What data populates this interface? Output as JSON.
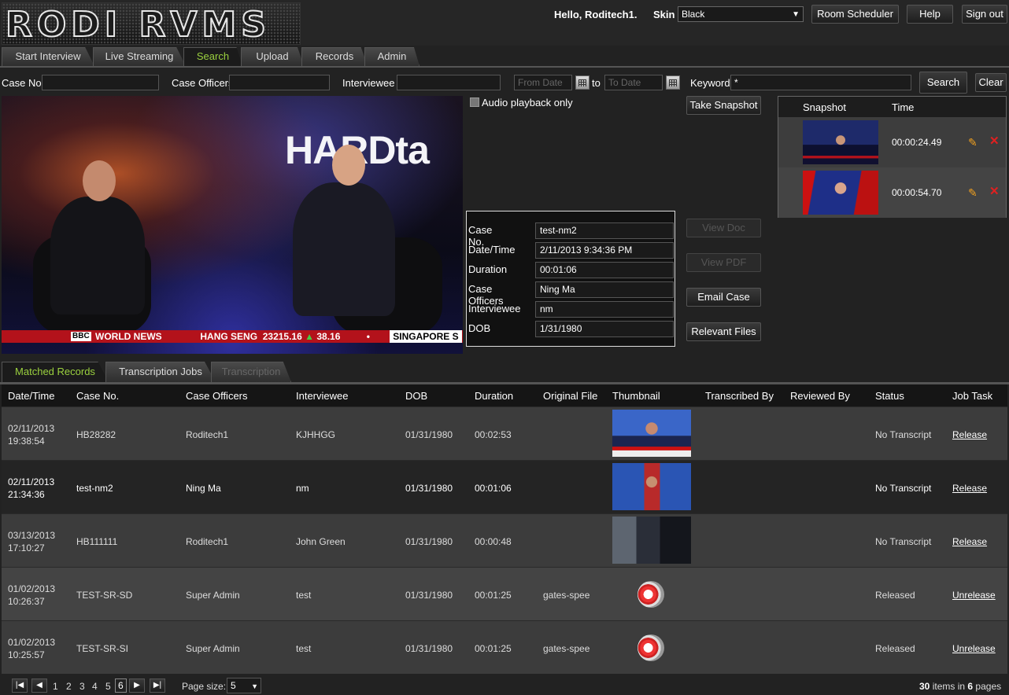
{
  "header": {
    "logo_text": "RODI RVMS",
    "greeting": "Hello, Roditech1.",
    "skin_label": "Skin",
    "skin_value": "Black",
    "buttons": {
      "room_scheduler": "Room Scheduler",
      "help": "Help",
      "sign_out": "Sign out"
    }
  },
  "main_tabs": [
    "Start Interview",
    "Live Streaming",
    "Search",
    "Upload",
    "Records",
    "Admin"
  ],
  "search": {
    "case_no_label": "Case No.",
    "case_officers_label": "Case Officers",
    "interviewee_label": "Interviewee",
    "from_date_placeholder": "From Date",
    "to_label": "to",
    "to_date_placeholder": "To Date",
    "keyword_label": "Keyword",
    "keyword_value": "*",
    "search_button": "Search",
    "clear_button": "Clear"
  },
  "video": {
    "overlay_text": "HARDta",
    "ticker_bbc": "BBC",
    "ticker_channel": "WORLD NEWS",
    "ticker_market1": "HANG SENG",
    "ticker_value1": "23215.16",
    "ticker_change1": "38.16",
    "ticker_market2": "SINGAPORE S"
  },
  "audio_only_label": "Audio playback only",
  "details": {
    "case_no_label": "Case No.",
    "case_no": "test-nm2",
    "datetime_label": "Date/Time",
    "datetime": "2/11/2013 9:34:36 PM",
    "duration_label": "Duration",
    "duration": "00:01:06",
    "officers_label": "Case Officers",
    "officers": "Ning Ma",
    "interviewee_label": "Interviewee",
    "interviewee": "nm",
    "dob_label": "DOB",
    "dob": "1/31/1980"
  },
  "actions": {
    "take_snapshot": "Take Snapshot",
    "view_doc": "View Doc",
    "view_pdf": "View PDF",
    "email_case": "Email Case",
    "relevant_files": "Relevant Files"
  },
  "snapshots": {
    "col_snapshot": "Snapshot",
    "col_time": "Time",
    "rows": [
      {
        "time": "00:00:24.49"
      },
      {
        "time": "00:00:54.70"
      }
    ]
  },
  "lower_tabs": [
    "Matched Records",
    "Transcription Jobs",
    "Transcription"
  ],
  "grid": {
    "columns": [
      "Date/Time",
      "Case No.",
      "Case Officers",
      "Interviewee",
      "DOB",
      "Duration",
      "Original File",
      "Thumbnail",
      "Transcribed By",
      "Reviewed By",
      "Status",
      "Job Task"
    ],
    "rows": [
      {
        "date": "02/11/2013",
        "time": "19:38:54",
        "case_no": "HB28282",
        "officers": "Roditech1",
        "interviewee": "KJHHGG",
        "dob": "01/31/1980",
        "duration": "00:02:53",
        "file": "",
        "status": "No Transcript",
        "task": "Release"
      },
      {
        "date": "02/11/2013",
        "time": "21:34:36",
        "case_no": "test-nm2",
        "officers": "Ning Ma",
        "interviewee": "nm",
        "dob": "01/31/1980",
        "duration": "00:01:06",
        "file": "",
        "status": "No Transcript",
        "task": "Release"
      },
      {
        "date": "03/13/2013",
        "time": "17:10:27",
        "case_no": "HB111111",
        "officers": "Roditech1",
        "interviewee": "John Green",
        "dob": "01/31/1980",
        "duration": "00:00:48",
        "file": "",
        "status": "No Transcript",
        "task": "Release"
      },
      {
        "date": "01/02/2013",
        "time": "10:26:37",
        "case_no": "TEST-SR-SD",
        "officers": "Super Admin",
        "interviewee": "test",
        "dob": "01/31/1980",
        "duration": "00:01:25",
        "file": "gates-spee",
        "status": "Released",
        "task": "Unrelease"
      },
      {
        "date": "01/02/2013",
        "time": "10:25:57",
        "case_no": "TEST-SR-SI",
        "officers": "Super Admin",
        "interviewee": "test",
        "dob": "01/31/1980",
        "duration": "00:01:25",
        "file": "gates-spee",
        "status": "Released",
        "task": "Unrelease"
      }
    ]
  },
  "pager": {
    "pages": [
      "1",
      "2",
      "3",
      "4",
      "5",
      "6"
    ],
    "current_page": "6",
    "page_size_label": "Page size:",
    "page_size": "5",
    "items_count": "30",
    "items_label": "items in",
    "pages_count": "6",
    "pages_label": "pages"
  }
}
